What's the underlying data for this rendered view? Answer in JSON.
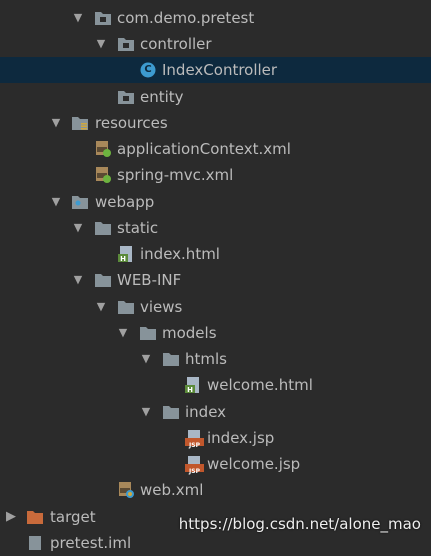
{
  "tree": {
    "package_pretest": "com.demo.pretest",
    "folder_controller": "controller",
    "file_indexcontroller": "IndexController",
    "class_badge": "C",
    "folder_entity": "entity",
    "folder_resources": "resources",
    "file_appcontext": "applicationContext.xml",
    "file_springmvc": "spring-mvc.xml",
    "folder_webapp": "webapp",
    "folder_static": "static",
    "file_indexhtml": "index.html",
    "folder_webinf": "WEB-INF",
    "folder_views": "views",
    "folder_models": "models",
    "folder_htmls": "htmls",
    "file_welcomehtml": "welcome.html",
    "folder_index": "index",
    "file_indexjsp": "index.jsp",
    "file_welcomejsp": "welcome.jsp",
    "file_webxml": "web.xml",
    "folder_target": "target",
    "file_pretestiml": "pretest.iml"
  },
  "badges": {
    "html": "H",
    "jsp": "JSP"
  },
  "watermark": "https://blog.csdn.net/alone_mao",
  "colors": {
    "background": "#2b2b2b",
    "selected_row": "#0d293e",
    "folder": "#87939a",
    "target_folder": "#c86a3b",
    "jsp_badge": "#c1572c",
    "html_badge": "#5b8a3a",
    "class_badge": "#3d9bd0"
  }
}
